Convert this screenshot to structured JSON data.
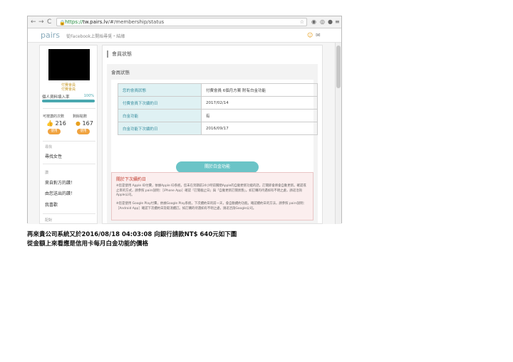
{
  "browser": {
    "back": "←",
    "forward": "→",
    "reload": "C",
    "url_scheme": "https://",
    "url_host": "tw.pairs.lv",
    "url_path": "/#/membership/status",
    "lock": "🔒",
    "star": "☆"
  },
  "site": {
    "logo": "pairs",
    "tagline": "從Facebook上開始尋覓・結緣",
    "right_icons": [
      "☺",
      "✉"
    ]
  },
  "sidebar": {
    "member_type": "付費會員",
    "member_sub": "付費會員",
    "rate_label": "個人資料填入率",
    "rate_value": "100%",
    "rate_fill": 1.0,
    "likes_label": "可按讚的次數",
    "likes_value": "216",
    "points_label": "剩餘點數",
    "points_value": "167",
    "use_label_1": "使用",
    "use_label_2": "使用",
    "section_search": "尋找",
    "item_search": "尋找女性",
    "section_likes": "讚",
    "item_liked_me": "來自對方的讚！",
    "item_i_liked": "由您送出的讚！",
    "item_favorites": "我喜歡",
    "section_msg": "配對"
  },
  "main": {
    "title": "會員狀態",
    "card_header": "會員狀態",
    "table": [
      {
        "key": "您的會員狀態",
        "value": "付費會員  6個月方案  附有白金功能"
      },
      {
        "key": "付費會員下次續約日",
        "value": "2017/02/14"
      },
      {
        "key": "白金功能",
        "value": "有"
      },
      {
        "key": "白金功能下次續約日",
        "value": "2016/09/17"
      }
    ],
    "platinum_button": "關於白金功能",
    "notice_title": "關於下次續約日",
    "notice_p1": "※您是使用 Apple ID付費，依據Apple ID系統，您未在到期前24小時前關閉Apple的自動更新功能的話，訂閱即會將會自動更新。確認或止目的方式，請參照 pairs說明：［iPhone App］確認「訂閱截止日」與「自動更新訂閱狀態」。如訂購的待遇如有不明之處，請逕洽詢Apple公司。",
    "notice_p2": "※您是使用 Google Play付費，依據Google Play系統，下次續約日的前一天，會自動續約功能。確認續約日的方法，請參照 pairs說明：［Android App］確認下次續約日及取消續訂。如訂購的待遇如有不明之處，請逕洽詢Google公司。"
  },
  "caption": {
    "line1": "再來貴公司系統又於2016/08/18 04:03:08 向銀行請款NT$ 640元如下圖",
    "line2": "從金額上來看應是信用卡每月白金功能的價格"
  }
}
